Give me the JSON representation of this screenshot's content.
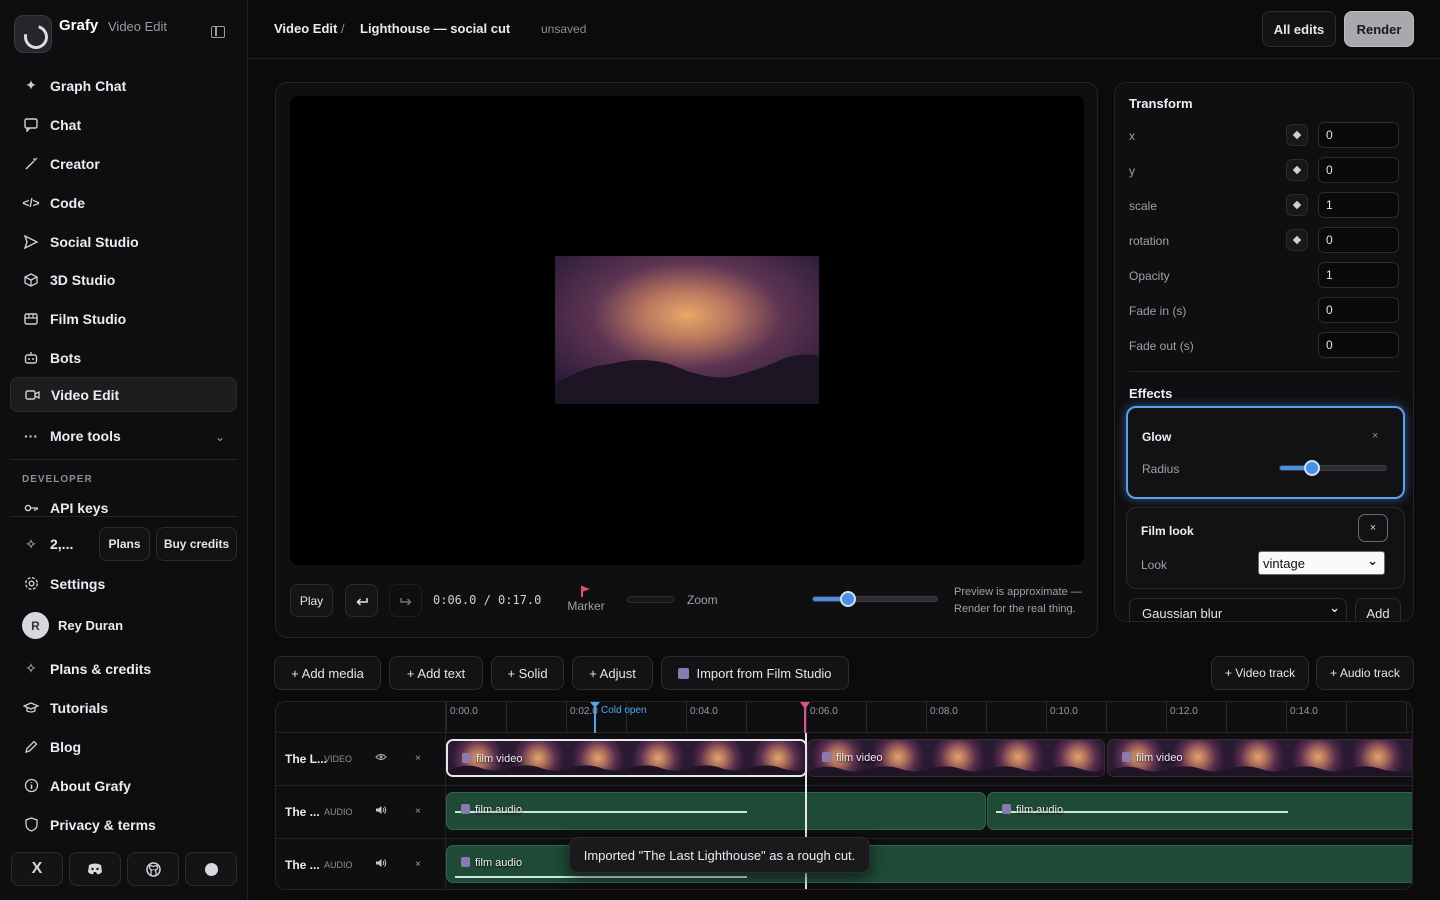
{
  "brand": {
    "name": "Grafy",
    "sub": "Video Edit"
  },
  "nav": [
    {
      "label": "Graph Chat",
      "icon": "sparkle-icon"
    },
    {
      "label": "Chat",
      "icon": "chat-icon"
    },
    {
      "label": "Creator",
      "icon": "wand-icon"
    },
    {
      "label": "Code",
      "icon": "code-icon"
    },
    {
      "label": "Social Studio",
      "icon": "send-icon"
    },
    {
      "label": "3D Studio",
      "icon": "cube-icon"
    },
    {
      "label": "Film Studio",
      "icon": "film-icon"
    },
    {
      "label": "Bots",
      "icon": "bot-icon"
    },
    {
      "label": "Video Edit",
      "icon": "video-icon",
      "active": true
    },
    {
      "label": "More tools",
      "icon": "more-icon"
    }
  ],
  "developer": {
    "section_label": "DEVELOPER",
    "api_keys": "API keys"
  },
  "credits": {
    "count": "2,...",
    "plans": "Plans",
    "buy": "Buy credits"
  },
  "account": [
    {
      "label": "Settings"
    }
  ],
  "user": {
    "initial": "R",
    "name": "Rey Duran"
  },
  "footer_nav": [
    {
      "label": "Plans & credits"
    },
    {
      "label": "Tutorials"
    },
    {
      "label": "Blog"
    },
    {
      "label": "About Grafy"
    },
    {
      "label": "Privacy & terms"
    }
  ],
  "socials": [
    "X",
    "discord-icon",
    "github-icon",
    "circle-icon"
  ],
  "header": {
    "crumb_root": "Video Edit",
    "crumb_sep": "/",
    "crumb_project": "Lighthouse — social cut",
    "status": "unsaved",
    "all_edits": "All edits",
    "render": "Render"
  },
  "preview": {
    "play": "Play",
    "timecode": "0:06.0 / 0:17.0",
    "marker": "Marker",
    "zoom": "Zoom",
    "zoom_level": 0.28,
    "note_line1": "Preview is approximate —",
    "note_line2": "Render for the real thing."
  },
  "inspector": {
    "transform_title": "Transform",
    "props": [
      {
        "label": "x",
        "value": "0",
        "keyframe": true
      },
      {
        "label": "y",
        "value": "0",
        "keyframe": true
      },
      {
        "label": "scale",
        "value": "1",
        "keyframe": true
      },
      {
        "label": "rotation",
        "value": "0",
        "keyframe": true
      },
      {
        "label": "Opacity",
        "value": "1",
        "keyframe": false
      },
      {
        "label": "Fade in (s)",
        "value": "0",
        "keyframe": false
      },
      {
        "label": "Fade out (s)",
        "value": "0",
        "keyframe": false
      }
    ],
    "effects_title": "Effects",
    "glow": {
      "name": "Glow",
      "close": "×",
      "param": "Radius",
      "level": 0.3
    },
    "film": {
      "name": "Film look",
      "close": "×",
      "param": "Look",
      "value": "vintage"
    },
    "add_effect": {
      "value": "Gaussian blur",
      "add": "Add"
    }
  },
  "toolbar": {
    "add_media": "+ Add media",
    "add_text": "+ Add text",
    "solid": "+ Solid",
    "adjust": "+ Adjust",
    "import": "Import from Film Studio",
    "video_track": "+ Video track",
    "audio_track": "+ Audio track"
  },
  "timeline": {
    "ticks": [
      "0:00.0",
      "0:02.0",
      "0:04.0",
      "0:06.0",
      "0:08.0",
      "0:10.0",
      "0:12.0",
      "0:14.0"
    ],
    "cue": "Cold open",
    "tracks": [
      {
        "name": "The L...",
        "kind": "VIDEO",
        "icon": "eye-icon",
        "remove": "×"
      },
      {
        "name": "The ...",
        "kind": "AUDIO",
        "icon": "speaker-icon",
        "remove": "×"
      },
      {
        "name": "The ...",
        "kind": "AUDIO",
        "icon": "speaker-icon",
        "remove": "×"
      }
    ],
    "video_clip": "film video",
    "audio_clip": "film audio"
  },
  "toast": "Imported \"The Last Lighthouse\" as a rough cut."
}
